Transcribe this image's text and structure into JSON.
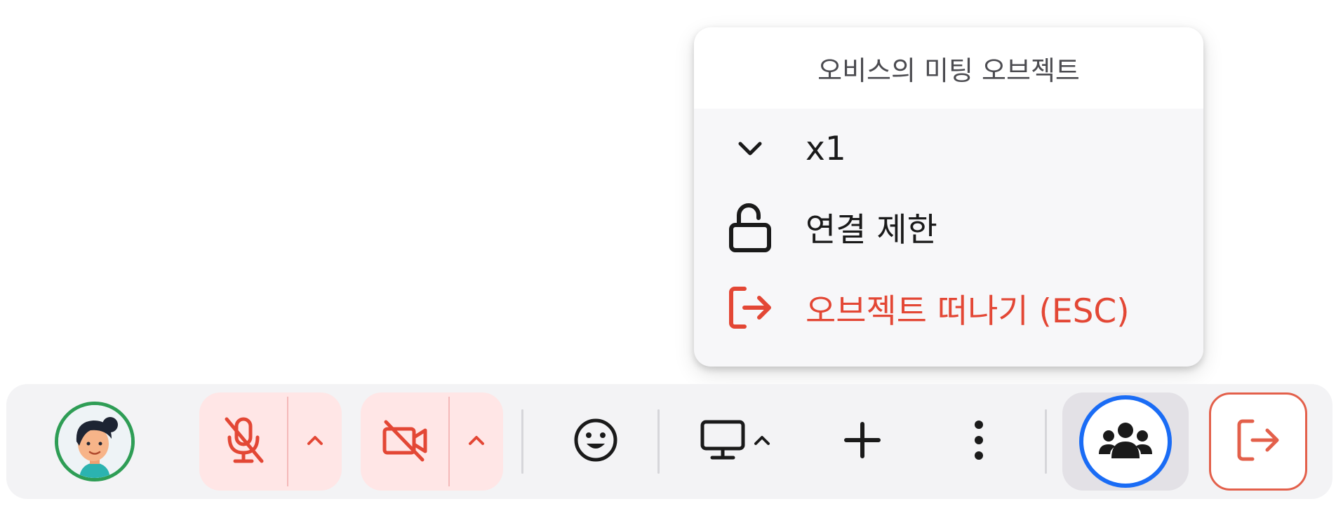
{
  "popup": {
    "title": "오비스의 미팅 오브젝트",
    "items": [
      {
        "icon": "chevron-down-icon",
        "label": "x1"
      },
      {
        "icon": "unlock-icon",
        "label": "연결 제한"
      },
      {
        "icon": "exit-icon",
        "label": "오브젝트 떠나기 (ESC)"
      }
    ]
  },
  "toolbar": {
    "avatar": "user-avatar",
    "microphone": {
      "state": "muted",
      "icon": "mic-off-icon",
      "caret_icon": "caret-up-icon"
    },
    "camera": {
      "state": "off",
      "icon": "camera-off-icon",
      "caret_icon": "caret-up-icon"
    },
    "emoji_icon": "smile-icon",
    "screen_share_icon": "monitor-icon",
    "add_icon": "plus-icon",
    "more_icon": "more-vertical-icon",
    "participants_icon": "people-icon",
    "leave_icon": "exit-icon"
  },
  "colors": {
    "danger": "#e34735",
    "danger_bg": "#ffe6e6",
    "active_ring": "#1a6cf5",
    "avatar_ring": "#2e9d55"
  }
}
